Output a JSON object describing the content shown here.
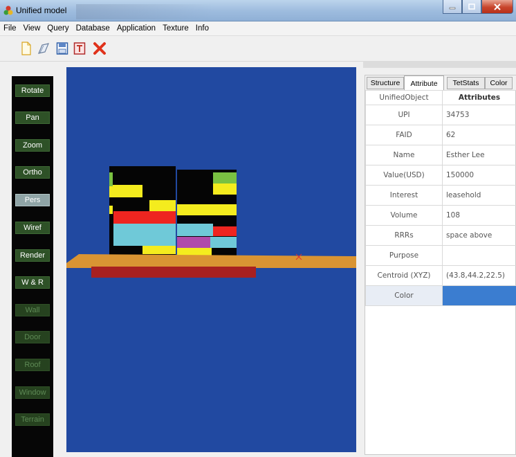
{
  "window": {
    "title": "Unified model"
  },
  "menu": [
    "File",
    "View",
    "Query",
    "Database",
    "Application",
    "Texture",
    "Info"
  ],
  "toolbar": {
    "icons": [
      "new-icon",
      "open-icon",
      "save-icon",
      "export-icon",
      "delete-icon"
    ]
  },
  "left_buttons": [
    "Rotate",
    "Pan",
    "Zoom",
    "Ortho",
    "Pers",
    "Wiref",
    "Render",
    "W & R",
    "Wall",
    "Door",
    "Roof",
    "Window",
    "Terrain"
  ],
  "tabs": [
    "Structure",
    "Attribute",
    "TetStats",
    "Color"
  ],
  "active_tab": "Attribute",
  "table": {
    "header": [
      "UnifiedObject",
      "Attributes"
    ],
    "rows": [
      {
        "key": "UPI",
        "value": "34753"
      },
      {
        "key": "FAID",
        "value": "62"
      },
      {
        "key": "Name",
        "value": "Esther Lee"
      },
      {
        "key": "Value(USD)",
        "value": "150000"
      },
      {
        "key": "Interest",
        "value": "leasehold"
      },
      {
        "key": "Volume",
        "value": "108"
      },
      {
        "key": "RRRs",
        "value": "space above"
      },
      {
        "key": "Purpose",
        "value": ""
      },
      {
        "key": "Centroid (XYZ)",
        "value": "(43.8,44.2,22.5)"
      },
      {
        "key": "Color",
        "value": ""
      }
    ],
    "color_swatch": "#3b7dd0"
  },
  "viewport": {
    "background": "#2149a1"
  }
}
